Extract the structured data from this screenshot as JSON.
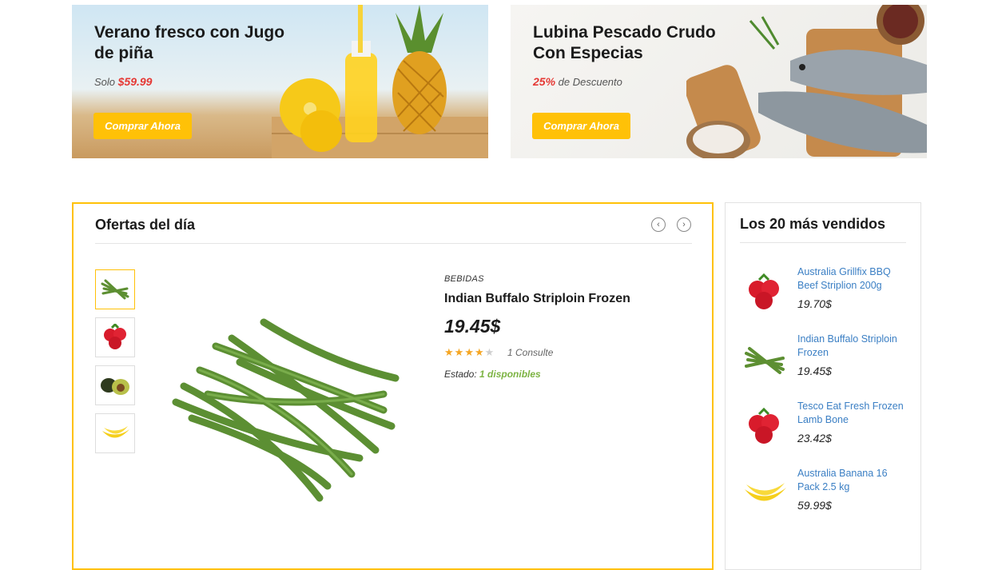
{
  "banners": [
    {
      "title": "Verano fresco con Jugo de piña",
      "sub_prefix": "Solo ",
      "sub_highlight": "$59.99",
      "sub_suffix": "",
      "button": "Comprar Ahora"
    },
    {
      "title": "Lubina Pescado Crudo Con Especias",
      "sub_prefix": "",
      "sub_highlight": "25%",
      "sub_suffix": " de Descuento",
      "button": "Comprar Ahora"
    }
  ],
  "deals": {
    "title": "Ofertas del día",
    "thumbnails": [
      "green-beans-icon",
      "strawberries-icon",
      "avocado-icon",
      "banana-icon"
    ],
    "product": {
      "category": "BEBIDAS",
      "name": "Indian Buffalo Striploin Frozen",
      "price": "19.45$",
      "rating": 4,
      "rating_max": 5,
      "reviews": "1 Consulte",
      "stock_label": "Estado: ",
      "stock_value": "1 disponibles"
    }
  },
  "bestsellers": {
    "title": "Los 20 más vendidos",
    "items": [
      {
        "name": "Australia Grillfix BBQ Beef Striplion 200g",
        "price": "19.70$",
        "icon": "strawberries-icon"
      },
      {
        "name": "Indian Buffalo Striploin Frozen",
        "price": "19.45$",
        "icon": "green-beans-icon"
      },
      {
        "name": "Tesco Eat Fresh Frozen Lamb Bone",
        "price": "23.42$",
        "icon": "strawberries-icon"
      },
      {
        "name": "Australia Banana 16 Pack 2.5 kg",
        "price": "59.99$",
        "icon": "banana-icon"
      }
    ]
  },
  "colors": {
    "accent": "#ffc107",
    "sale_red": "#e53935",
    "link_blue": "#3b7fc4",
    "stock_green": "#7cb342"
  }
}
